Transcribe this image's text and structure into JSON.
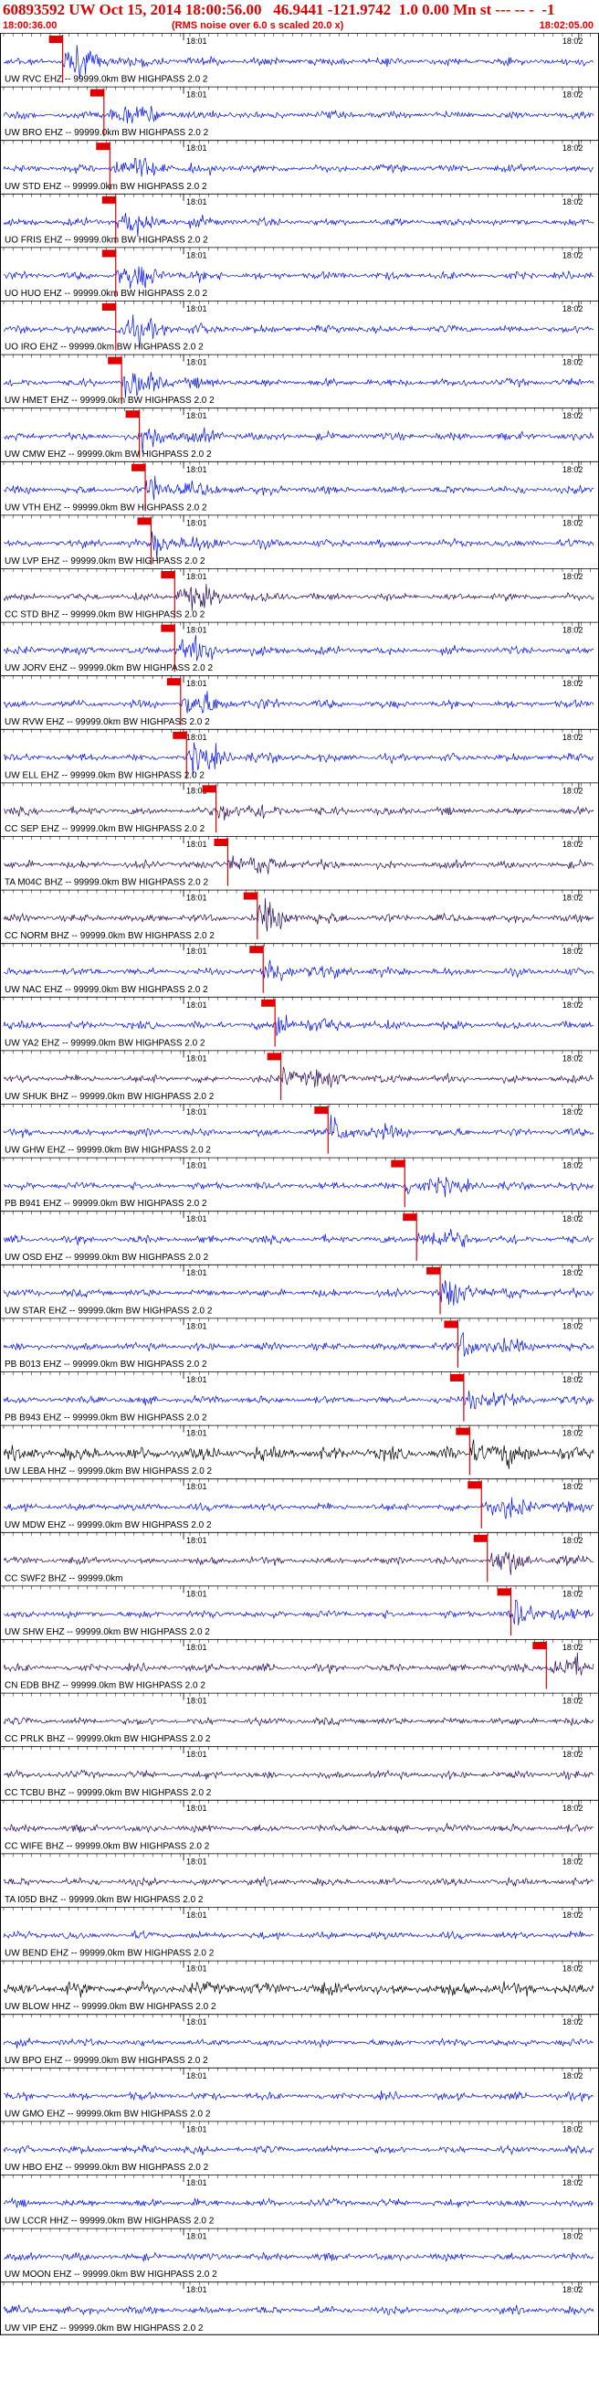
{
  "header": {
    "title": "60893592 UW Oct 15, 2014 18:00:56.00   46.9441 -121.9742  1.0 0.00 Mn st --- -- -  -1",
    "start_time": "18:00:36.00",
    "end_time": "18:02:05.00",
    "scale_note": "(RMS noise over 6.0 s scaled 20.0 x)"
  },
  "colors": {
    "trace_blue": "#0010ee",
    "trace_purple": "#2a0a5a",
    "trace_black": "#000000",
    "pick_red": "#e00000",
    "bg": "#ffffff"
  },
  "chart_data": {
    "type": "line",
    "title": "60893592 UW Oct 15, 2014 18:00:56.00   46.9441 -121.9742  1.0 0.00 Mn st --- -- -  -1",
    "x_range": [
      "18:00:36.00",
      "18:02:05.00"
    ],
    "minute_ticks": [
      "18:01",
      "18:02"
    ],
    "series": [
      {
        "name": "UW RVC EHZ -- 99999.0km BW HIGHPASS 2.0 2",
        "color": "blue",
        "pick_position": 0.1
      },
      {
        "name": "UW BRO EHZ -- 99999.0km BW HIGHPASS 2.0 2",
        "color": "blue",
        "pick_position": 0.17
      },
      {
        "name": "UW STD EHZ -- 99999.0km BW HIGHPASS 2.0 2",
        "color": "blue",
        "pick_position": 0.18
      },
      {
        "name": "UO FRIS EHZ -- 99999.0km BW HIGHPASS 2.0 2",
        "color": "blue",
        "pick_position": 0.19
      },
      {
        "name": "UO HUO EHZ -- 99999.0km BW HIGHPASS 2.0 2",
        "color": "blue",
        "pick_position": 0.19
      },
      {
        "name": "UO IRO EHZ -- 99999.0km BW HIGHPASS 2.0 2",
        "color": "blue",
        "pick_position": 0.19
      },
      {
        "name": "UW HMET EHZ -- 99999.0km BW HIGHPASS 2.0 2",
        "color": "blue",
        "pick_position": 0.2
      },
      {
        "name": "UW CMW EHZ -- 99999.0km BW HIGHPASS 2.0 2",
        "color": "blue",
        "pick_position": 0.23
      },
      {
        "name": "UW VTH EHZ -- 99999.0km BW HIGHPASS 2.0 2",
        "color": "blue",
        "pick_position": 0.24
      },
      {
        "name": "UW LVP EHZ -- 99999.0km BW HIGHPASS 2.0 2",
        "color": "blue",
        "pick_position": 0.25
      },
      {
        "name": "CC STD BHZ -- 99999.0km BW HIGHPASS 2.0 2",
        "color": "purple",
        "pick_position": 0.29
      },
      {
        "name": "UW JORV EHZ -- 99999.0km BW HIGHPASS 2.0 2",
        "color": "blue",
        "pick_position": 0.29
      },
      {
        "name": "UW RVW EHZ -- 99999.0km BW HIGHPASS 2.0 2",
        "color": "blue",
        "pick_position": 0.3
      },
      {
        "name": "UW ELL EHZ -- 99999.0km BW HIGHPASS 2.0 2",
        "color": "blue",
        "pick_position": 0.31
      },
      {
        "name": "CC SEP EHZ -- 99999.0km BW HIGHPASS 2.0 2",
        "color": "purple",
        "pick_position": 0.36
      },
      {
        "name": "TA M04C BHZ -- 99999.0km BW HIGHPASS 2.0 2",
        "color": "purple",
        "pick_position": 0.38
      },
      {
        "name": "CC NORM BHZ -- 99999.0km BW HIGHPASS 2.0 2",
        "color": "purple",
        "pick_position": 0.43
      },
      {
        "name": "UW NAC EHZ -- 99999.0km BW HIGHPASS 2.0 2",
        "color": "blue",
        "pick_position": 0.44
      },
      {
        "name": "UW YA2 EHZ -- 99999.0km BW HIGHPASS 2.0 2",
        "color": "blue",
        "pick_position": 0.46
      },
      {
        "name": "UW SHUK BHZ -- 99999.0km BW HIGHPASS 2.0 2",
        "color": "purple",
        "pick_position": 0.47
      },
      {
        "name": "UW GHW EHZ -- 99999.0km BW HIGHPASS 2.0 2",
        "color": "blue",
        "pick_position": 0.55
      },
      {
        "name": "PB B941 EHZ -- 99999.0km BW HIGHPASS 2.0 2",
        "color": "blue",
        "pick_position": 0.68
      },
      {
        "name": "UW OSD EHZ -- 99999.0km BW HIGHPASS 2.0 2",
        "color": "blue",
        "pick_position": 0.7
      },
      {
        "name": "UW STAR EHZ -- 99999.0km BW HIGHPASS 2.0 2",
        "color": "blue",
        "pick_position": 0.74
      },
      {
        "name": "PB B013 EHZ -- 99999.0km BW HIGHPASS 2.0 2",
        "color": "blue",
        "pick_position": 0.77
      },
      {
        "name": "PB B943 EHZ -- 99999.0km BW HIGHPASS 2.0 2",
        "color": "blue",
        "pick_position": 0.78
      },
      {
        "name": "UW LEBA HHZ -- 99999.0km BW HIGHPASS 2.0 2",
        "color": "black",
        "pick_position": 0.79
      },
      {
        "name": "UW MDW EHZ -- 99999.0km BW HIGHPASS 2.0 2",
        "color": "blue",
        "pick_position": 0.81
      },
      {
        "name": "CC SWF2 BHZ -- 99999.0km",
        "color": "purple",
        "pick_position": 0.82
      },
      {
        "name": "UW SHW EHZ -- 99999.0km BW HIGHPASS 2.0 2",
        "color": "blue",
        "pick_position": 0.86
      },
      {
        "name": "CN EDB BHZ -- 99999.0km BW HIGHPASS 2.0 2",
        "color": "purple",
        "pick_position": 0.92
      },
      {
        "name": "CC PRLK BHZ -- 99999.0km BW HIGHPASS 2.0 2",
        "color": "purple",
        "pick_position": null
      },
      {
        "name": "CC TCBU BHZ -- 99999.0km BW HIGHPASS 2.0 2",
        "color": "purple",
        "pick_position": null
      },
      {
        "name": "CC WIFE BHZ -- 99999.0km BW HIGHPASS 2.0 2",
        "color": "purple",
        "pick_position": null
      },
      {
        "name": "TA I05D BHZ -- 99999.0km BW HIGHPASS 2.0 2",
        "color": "purple",
        "pick_position": null
      },
      {
        "name": "UW BEND EHZ -- 99999.0km BW HIGHPASS 2.0 2",
        "color": "blue",
        "pick_position": null
      },
      {
        "name": "UW BLOW HHZ -- 99999.0km BW HIGHPASS 2.0 2",
        "color": "black",
        "pick_position": null
      },
      {
        "name": "UW BPO EHZ -- 99999.0km BW HIGHPASS 2.0 2",
        "color": "blue",
        "pick_position": null
      },
      {
        "name": "UW GMO EHZ -- 99999.0km BW HIGHPASS 2.0 2",
        "color": "blue",
        "pick_position": null
      },
      {
        "name": "UW HBO EHZ -- 99999.0km BW HIGHPASS 2.0 2",
        "color": "blue",
        "pick_position": null
      },
      {
        "name": "UW LCCR HHZ -- 99999.0km BW HIGHPASS 2.0 2",
        "color": "blue",
        "pick_position": null
      },
      {
        "name": "UW MOON EHZ -- 99999.0km BW HIGHPASS 2.0 2",
        "color": "blue",
        "pick_position": null
      },
      {
        "name": "UW VIP EHZ -- 99999.0km BW HIGHPASS 2.0 2",
        "color": "blue",
        "pick_position": null
      }
    ]
  }
}
